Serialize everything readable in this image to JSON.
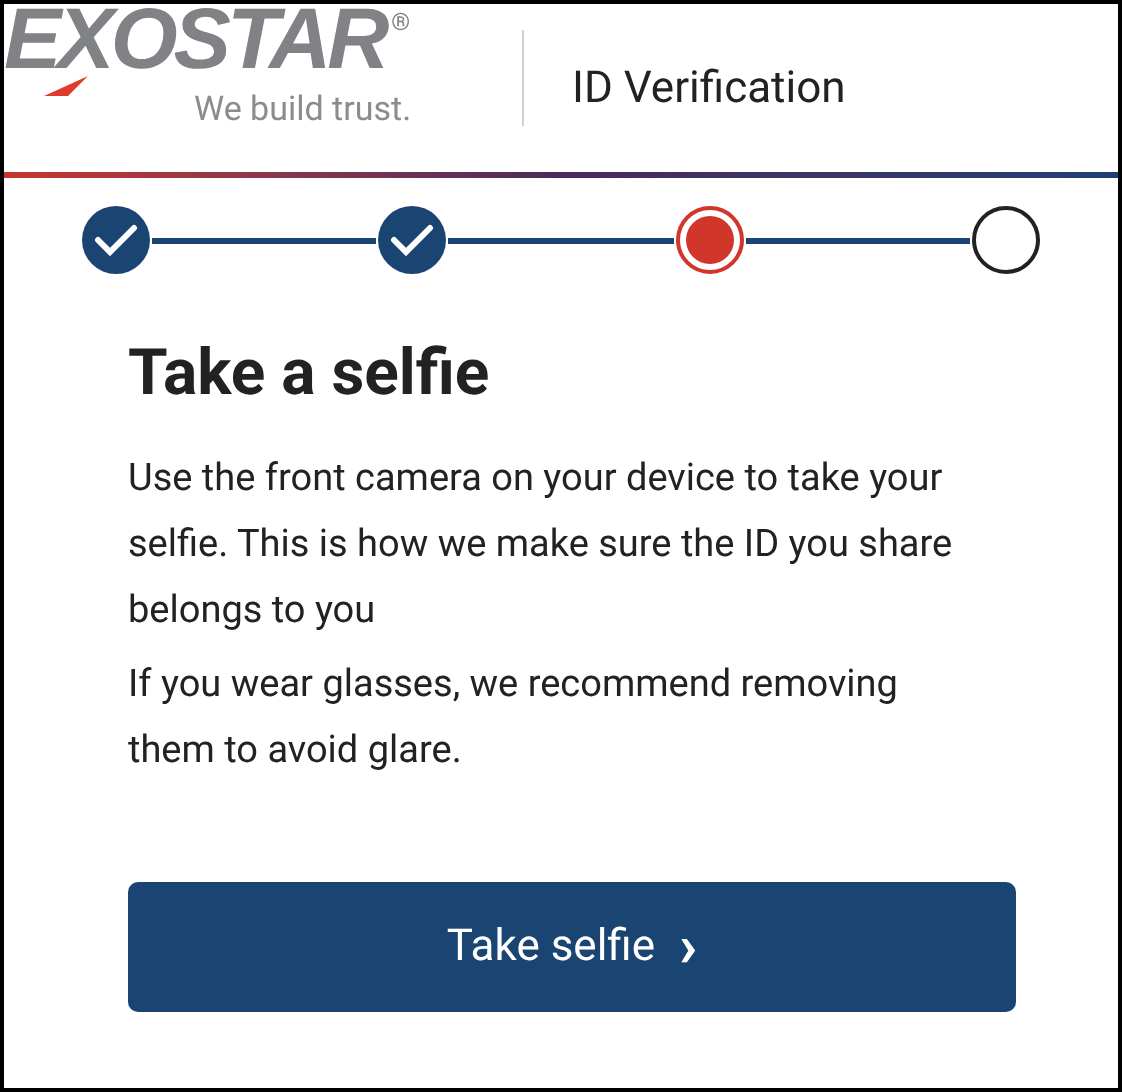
{
  "header": {
    "logo": "EXOSTAR",
    "registered_mark": "®",
    "tagline": "We build trust.",
    "title": "ID Verification"
  },
  "steps": [
    {
      "completed": true,
      "current": false
    },
    {
      "completed": true,
      "current": false
    },
    {
      "completed": false,
      "current": true
    },
    {
      "completed": false,
      "current": false
    }
  ],
  "heading": "Take a selfie",
  "paragraphs": [
    "Use the front camera on your device to take your selfie. This is how we make sure the ID you share belongs to you",
    "If you wear glasses, we recommend removing them to avoid glare."
  ],
  "button": {
    "label": "Take selfie",
    "arrow": "›"
  }
}
